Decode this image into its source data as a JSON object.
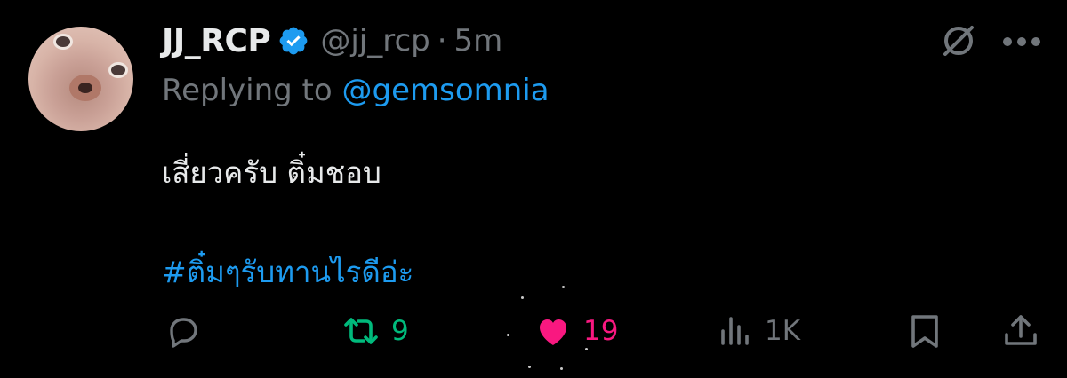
{
  "tweet": {
    "display_name": "JJ_RCP",
    "handle": "@jj_rcp",
    "separator": "·",
    "time": "5m",
    "replying_prefix": "Replying to",
    "replying_to": "@gemsomnia",
    "text": "เสี่ยวครับ ติ๋มชอบ",
    "hashtag": "#ติ๋มๆรับทานไรดีอ่ะ"
  },
  "actions": {
    "retweets": "9",
    "likes": "19",
    "views": "1K"
  },
  "icons": {
    "verified": "verified-badge-icon",
    "grok": "grok-icon",
    "more": "more-options-icon",
    "reply": "reply-icon",
    "retweet": "retweet-icon",
    "like": "heart-icon",
    "views": "views-icon",
    "bookmark": "bookmark-icon",
    "share": "share-icon"
  },
  "colors": {
    "background": "#000000",
    "text": "#e7e9ea",
    "muted": "#71767b",
    "link": "#1d9bf0",
    "retweet": "#00ba7c",
    "like": "#f91880"
  }
}
